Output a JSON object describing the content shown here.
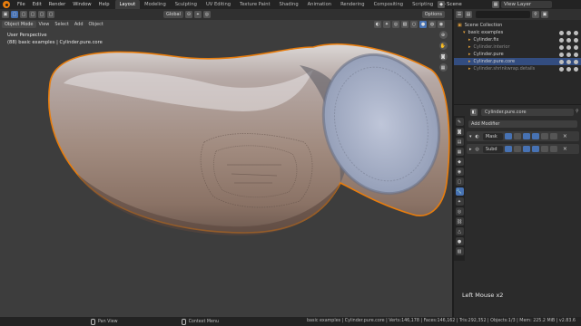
{
  "menu": [
    "File",
    "Edit",
    "Render",
    "Window",
    "Help"
  ],
  "workspaces": [
    "Layout",
    "Modeling",
    "Sculpting",
    "UV Editing",
    "Texture Paint",
    "Shading",
    "Animation",
    "Rendering",
    "Compositing",
    "Scripting"
  ],
  "active_workspace": "Layout",
  "scene_label": "Scene",
  "view_layer_label": "View Layer",
  "viewport": {
    "mode": "Object Mode",
    "menus": [
      "View",
      "Select",
      "Add",
      "Object"
    ],
    "transform_orientation": "Global",
    "options_label": "Options",
    "info_line1": "User Perspective",
    "info_line2": "(88) basic examples | Cylinder.pure.core"
  },
  "outliner": {
    "rows": [
      {
        "label": "Scene Collection",
        "indent": 0,
        "selected": false,
        "dim": false
      },
      {
        "label": "basic examples",
        "indent": 1,
        "selected": false,
        "dim": false
      },
      {
        "label": "Cylinder.fix",
        "indent": 2,
        "selected": false,
        "dim": false
      },
      {
        "label": "Cylinder.interior",
        "indent": 2,
        "selected": false,
        "dim": true
      },
      {
        "label": "Cylinder.pure",
        "indent": 2,
        "selected": false,
        "dim": false
      },
      {
        "label": "Cylinder.pure.core",
        "indent": 2,
        "selected": true,
        "dim": false
      },
      {
        "label": "Cylinder.shrinkwrap.details",
        "indent": 2,
        "selected": false,
        "dim": true
      }
    ]
  },
  "properties": {
    "object_name": "Cylinder.pure.core",
    "add_modifier": "Add Modifier",
    "modifiers": [
      {
        "name": "Mask"
      },
      {
        "name": "Subd"
      }
    ],
    "last_operation": "Left Mouse x2"
  },
  "statusbar": {
    "left_hint": "Pan View",
    "middle_hint": "Context Menu",
    "stats": "basic examples | Cylinder.pure.core | Verts:146,178 | Faces:146,162 | Tris:292,352 | Objects:1/3 | Mem: 225.2 MiB | v2.83.6"
  },
  "colors": {
    "accent": "#4772b3",
    "selection_outline": "#e87d0d",
    "viewport_bg": "#3d3d3d"
  }
}
